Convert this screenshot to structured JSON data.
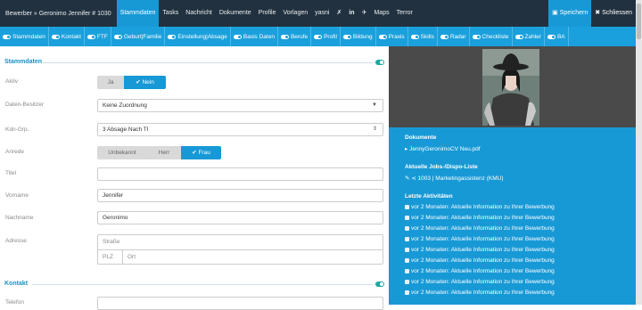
{
  "topbar": {
    "breadcrumb": "Bewerber » Geronimo Jennifer # 1030",
    "nav": [
      "Stammdaten",
      "Tasks",
      "Nachricht",
      "Dokumente",
      "Profile",
      "Vorlagen",
      "yasni"
    ],
    "nav_active": "Stammdaten",
    "nav_after_icons": [
      "Maps",
      "Terror"
    ],
    "save_label": "Speichern",
    "close_label": "Schliessen"
  },
  "tabs": [
    "Stammdaten",
    "Kontakt",
    "FTF",
    "Geburt|Familie",
    "Einstellung|Absage",
    "Basis Daten",
    "Berufe",
    "Profil",
    "Bildung",
    "Praxis",
    "Skills",
    "Radar",
    "Checkliste",
    "Zahler",
    "BA"
  ],
  "form": {
    "section_stammdaten": "Stammdaten",
    "aktiv": {
      "label": "Aktiv",
      "options": [
        "Ja",
        "✔ Nein"
      ],
      "selected": "Nein"
    },
    "daten_besitzer": {
      "label": "Daten-Besitzer",
      "value": "Keine Zuordnung"
    },
    "kdn_grp": {
      "label": "Kdn-Grp.",
      "value": "3 Absage Nach TI"
    },
    "anrede": {
      "label": "Anrede",
      "options": [
        "Unbekannt",
        "Herr",
        "✔ Frau"
      ],
      "selected": "Frau"
    },
    "titel": {
      "label": "Titel",
      "value": ""
    },
    "vorname": {
      "label": "Vorname",
      "value": "Jennifer"
    },
    "nachname": {
      "label": "Nachname",
      "value": "Geronimo"
    },
    "adresse": {
      "label": "Adresse",
      "strasse": "Straße",
      "plz": "PLZ",
      "ort": "Ort"
    },
    "section_kontakt": "Kontakt",
    "telefon": {
      "label": "Telefon"
    }
  },
  "side": {
    "dokumente_title": "Dokumente",
    "dokument": "JennyGeronimoCV Neu.pdf",
    "jobs_title": "Aktuelle Jobs-/Dispo-Liste",
    "job": "1003 | Marketingassistenz (KMU)",
    "aktiv_title": "Letzte Aktivitäten",
    "activities": [
      "vor 2 Monaten: Aktuelle Information zu Ihrer Bewerbung",
      "vor 2 Monaten: Aktuelle Information zu Ihrer Bewerbung",
      "vor 2 Monaten: Aktuelle Information zu Ihrer Bewerbung",
      "vor 2 Monaten: Aktuelle Information zu Ihrer Bewerbung",
      "vor 2 Monaten: Aktuelle Information zu Ihrer Bewerbung",
      "vor 2 Monaten: Aktuelle Information zu Ihrer Bewerbung",
      "vor 2 Monaten: Aktuelle Information zu Ihrer Bewerbung",
      "vor 2 Monaten: Aktuelle Information zu Ihrer Bewerbung",
      "vor 2 Monaten: Aktuelle Information zu Ihrer Bewerbung"
    ]
  },
  "colors": {
    "topbar": "#22313f",
    "accent": "#1799d6",
    "tabbar": "#1aa0dc"
  }
}
